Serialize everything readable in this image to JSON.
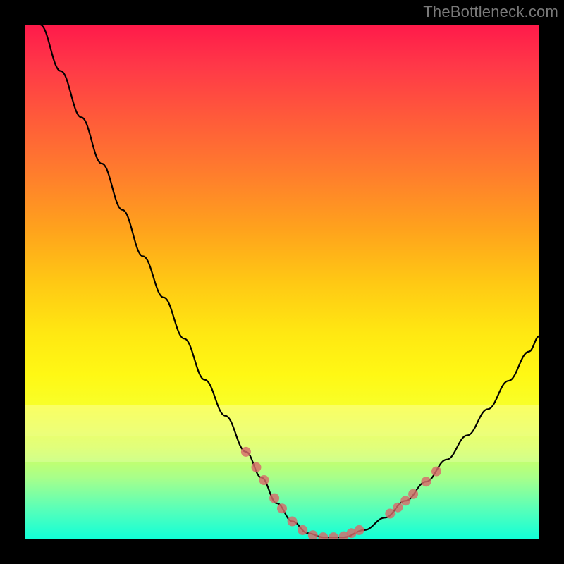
{
  "watermark": "TheBottleneck.com",
  "chart_data": {
    "type": "line",
    "title": "",
    "xlabel": "",
    "ylabel": "",
    "xlim": [
      0,
      100
    ],
    "ylim": [
      0,
      100
    ],
    "background_gradient": {
      "orientation": "vertical",
      "stops": [
        {
          "pos": 0,
          "color": "#ff1a4a"
        },
        {
          "pos": 50,
          "color": "#ffc814"
        },
        {
          "pos": 74,
          "color": "#f8ff28"
        },
        {
          "pos": 100,
          "color": "#10ffd8"
        }
      ]
    },
    "series": [
      {
        "name": "bottleneck-curve",
        "color": "#000000",
        "x": [
          3,
          7,
          11,
          15,
          19,
          23,
          27,
          31,
          35,
          39,
          43,
          46,
          49,
          52,
          55,
          58,
          62,
          66,
          70,
          74,
          78,
          82,
          86,
          90,
          94,
          98,
          100
        ],
        "y": [
          100,
          91,
          82,
          73,
          64,
          55,
          47,
          39,
          31,
          24,
          17,
          12,
          7,
          3.5,
          1.2,
          0.4,
          0.4,
          1.8,
          4.2,
          7.5,
          11.2,
          15.5,
          20.2,
          25.3,
          30.8,
          36.5,
          39.5
        ]
      }
    ],
    "markers": {
      "name": "highlight-dots",
      "color": "#d86a6a",
      "radius": 7,
      "points": [
        {
          "x": 43,
          "y": 17
        },
        {
          "x": 45,
          "y": 14
        },
        {
          "x": 46.5,
          "y": 11.5
        },
        {
          "x": 48.5,
          "y": 8
        },
        {
          "x": 50,
          "y": 6
        },
        {
          "x": 52,
          "y": 3.5
        },
        {
          "x": 54,
          "y": 1.8
        },
        {
          "x": 56,
          "y": 0.8
        },
        {
          "x": 58,
          "y": 0.4
        },
        {
          "x": 60,
          "y": 0.4
        },
        {
          "x": 62,
          "y": 0.6
        },
        {
          "x": 63.5,
          "y": 1.2
        },
        {
          "x": 65,
          "y": 1.8
        },
        {
          "x": 71,
          "y": 5
        },
        {
          "x": 72.5,
          "y": 6.2
        },
        {
          "x": 74,
          "y": 7.5
        },
        {
          "x": 75.5,
          "y": 8.8
        },
        {
          "x": 78,
          "y": 11.2
        },
        {
          "x": 80,
          "y": 13.2
        }
      ]
    }
  }
}
